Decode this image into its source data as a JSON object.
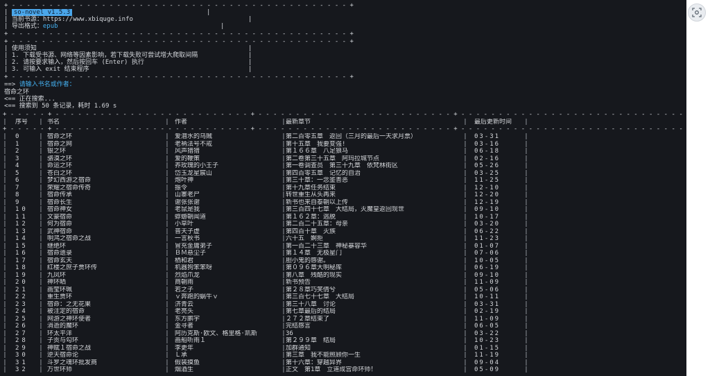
{
  "header_box": {
    "border": "+ - - - - - - - - - - - - - - - - - - - - - - - - - - - - - - - - - - - - - - - - - - - - - +",
    "app_version": "so-novel v1.5.3",
    "source_label": "当前书源：",
    "source_url": "https://www.xbiquge.info",
    "format_label": "导出格式：",
    "format_value": "epub"
  },
  "notice_box": {
    "border": "+ - - - - - - - - - - - - - - - - - - - - - - - - - - - - - - - - - - - - - - - - - - - - - +",
    "title": "使用须知",
    "items": [
      "1. 下载受书源、网络等因素影响，若下载失败可尝试增大爬取间隔",
      "2. 请按要求输入，然后按回车 (Enter) 执行",
      "3. 可输入 exit 结束程序"
    ]
  },
  "prompt": {
    "arrow": "==>",
    "text": "请输入书名或作者：",
    "input": "宿命之环",
    "searching": "<== 正在搜索...",
    "result": "<== 搜索到 50 条记录，耗时 1.69 s"
  },
  "table": {
    "border": "+ - - - - - + - - - - - - - - - - - - - - - - - - - - - - - - - - + - - - - - - - - - - - - - - - - - - - - - - - - - - + - - - - - - - - - - - - - - - - - - - - - - - - - - - - - - - - - - - - - - - - + - - - - - - - - - - - - - - +",
    "headers": [
      "序号",
      "书名",
      "作者",
      "最新章节",
      "最后更新时间"
    ],
    "rows": [
      [
        "0",
        "宿命之环",
        "爱潜水的乌贼",
        "第二百零五章　返回（三月的最后一天求月票）",
        "03-31"
      ],
      [
        "1",
        "宿命之网",
        "老衲法号不戒",
        "第十五章　我要变强!",
        "03-16"
      ],
      [
        "2",
        "银之环",
        "风声猎猎",
        "第１６６章　八足狼马",
        "06-18"
      ],
      [
        "3",
        "骆漠之环",
        "爱的鞭策",
        "第二卷第三十五章　阿玛拉城节点",
        "02-16"
      ],
      [
        "4",
        "命运之环",
        "养玫瑰的小王子",
        "第一卷调查员　第三十九章　依梵林街区",
        "05-26"
      ],
      [
        "5",
        "苍白之环",
        "岱玉龙星宸山",
        "第四百零五章　记忆的自治",
        "03-25"
      ],
      [
        "6",
        "梦幻西游之宿命",
        "炮叶神",
        "第三十章：一念鉴善恶",
        "11-25"
      ],
      [
        "7",
        "荣耀之宿命传奇",
        "振令",
        "第十九章任务结束",
        "12-10"
      ],
      [
        "8",
        "宿命传承",
        "山寨老尸",
        "转世重生从头再来",
        "12-20"
      ],
      [
        "9",
        "宿命长生",
        "谢张张谢",
        "新书也来自泰朝以上传",
        "12-19"
      ],
      [
        "10",
        "宿命神女",
        "老鼠是我",
        "第三百四十七章　大结局，灭魔皇返回现世",
        "09-10"
      ],
      [
        "11",
        "文豪宿命",
        "蜉蝣朝闻道",
        "第１６２章：逃脱",
        "10-17"
      ],
      [
        "12",
        "何为宿命",
        "小草叶",
        "第二百二十五章：母亲",
        "03-20"
      ],
      [
        "13",
        "武神宿命",
        "普天子虚",
        "第四百十章　灭族",
        "06-22"
      ],
      [
        "14",
        "明鸿之宿命之战",
        "一言秋书",
        "六十五　婀拒",
        "11-23"
      ],
      [
        "15",
        "继绝环",
        "冒充金庸弟子",
        "第一百二十三章　神秘暴容华",
        "01-07"
      ],
      [
        "16",
        "宿命遗录",
        "ＢＭ悬尘子",
        "第１４章　无极星门",
        "07-06"
      ],
      [
        "17",
        "宿命玄天",
        "栖和君",
        "胆小鬼的感谢。",
        "10-05"
      ],
      [
        "18",
        "红楼之庶子贾环传",
        "机器狗笨笨呀",
        "第０９６章大明秘库",
        "06-19"
      ],
      [
        "19",
        "九凤环",
        "烈焰爪龙",
        "第八章　残酷的现实",
        "09-10"
      ],
      [
        "20",
        "神环晒",
        "商朝雨",
        "新书预告",
        "11-09"
      ],
      [
        "21",
        "画莹环珮",
        "若之子",
        "第２８章巧笑倩兮",
        "05-06"
      ],
      [
        "22",
        "重生贾环",
        "ｖ奔跑的蜗牛ｖ",
        "第三百七十七章　大结局",
        "10-11"
      ],
      [
        "23",
        "宿命：之无花果",
        "济青云",
        "第三十八章　讨论",
        "03-31"
      ],
      [
        "24",
        "被注定的宿命",
        "老亮头",
        "第七章最后的结局",
        "02-19"
      ],
      [
        "25",
        "网游之神环使者",
        "东方鹏宇",
        "２７２章结束了",
        "11-09"
      ],
      [
        "26",
        "消逝的魔环",
        "金寻者",
        "完结感言",
        "06-05"
      ],
      [
        "27",
        "环太平洋",
        "阿历克斯·欧文、格里格·凯斯",
        "36",
        "03-22"
      ],
      [
        "28",
        "子贡与勾环",
        "画船听雨１",
        "第２９９章　结局",
        "10-23"
      ],
      [
        "29",
        "神赋１宿命之战",
        "李更年",
        "加群通知",
        "01-15"
      ],
      [
        "30",
        "逆天宿命论",
        "Ｌ承",
        "第三章　我不能照顾你一生",
        "11-19"
      ],
      [
        "31",
        "斗罗之魂环批发商",
        "假装摸鱼",
        "第十六章：穿越异界",
        "09-04"
      ],
      [
        "32",
        "万世环师",
        "烟酒生",
        "正文　第1章　立道成宫命环师！",
        "05-09"
      ]
    ]
  },
  "icons": {
    "scan_button": "lens-scan-icon"
  }
}
